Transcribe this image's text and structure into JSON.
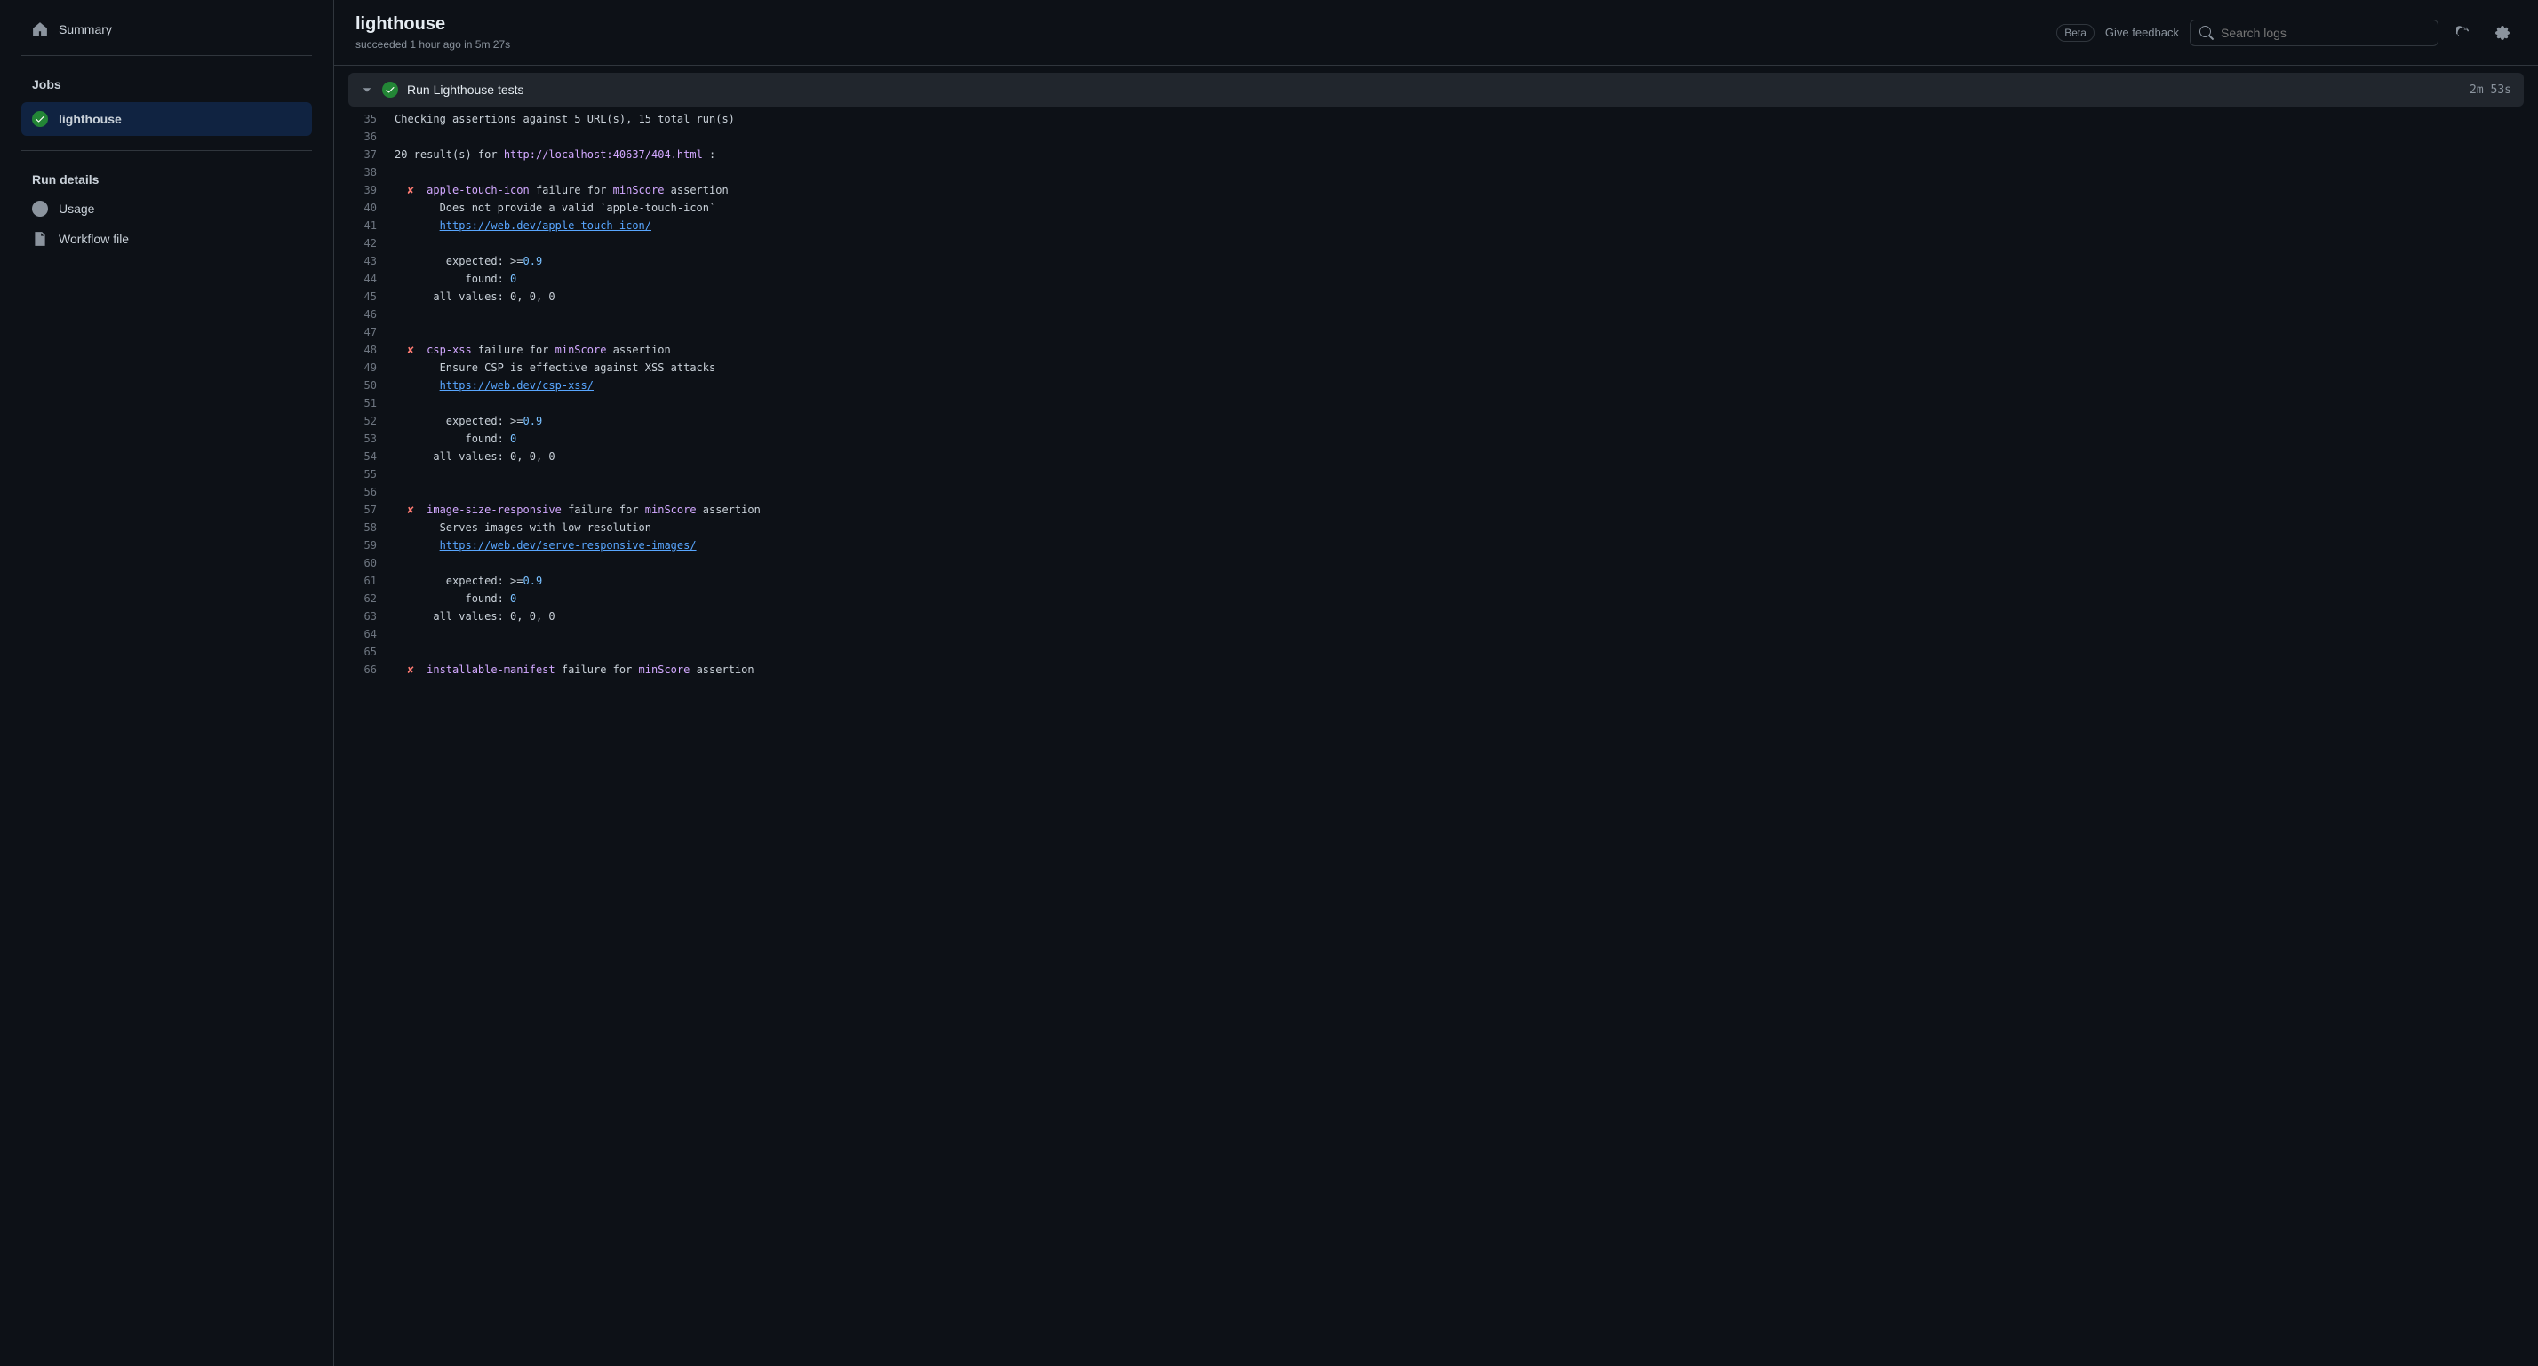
{
  "sidebar": {
    "summary_label": "Summary",
    "jobs_heading": "Jobs",
    "job_name": "lighthouse",
    "run_details_heading": "Run details",
    "usage_label": "Usage",
    "workflow_file_label": "Workflow file"
  },
  "header": {
    "title": "lighthouse",
    "subtitle": "succeeded 1 hour ago in 5m 27s",
    "beta_label": "Beta",
    "feedback_label": "Give feedback",
    "search_placeholder": "Search logs"
  },
  "step": {
    "title": "Run Lighthouse tests",
    "duration": "2m 53s"
  },
  "log": [
    {
      "n": "35",
      "segs": [
        {
          "t": "Checking assertions against 5 URL(s), 15 total run(s)",
          "c": "plain"
        }
      ]
    },
    {
      "n": "36",
      "segs": []
    },
    {
      "n": "37",
      "segs": [
        {
          "t": "20 result(s) for ",
          "c": "plain"
        },
        {
          "t": "http://localhost:40637/404.html",
          "c": "kw"
        },
        {
          "t": " :",
          "c": "plain"
        }
      ]
    },
    {
      "n": "38",
      "segs": []
    },
    {
      "n": "39",
      "segs": [
        {
          "t": "  ✘  ",
          "c": "fail"
        },
        {
          "t": "apple-touch-icon",
          "c": "kw"
        },
        {
          "t": " failure for ",
          "c": "plain"
        },
        {
          "t": "minScore",
          "c": "kw"
        },
        {
          "t": " assertion",
          "c": "plain"
        }
      ]
    },
    {
      "n": "40",
      "segs": [
        {
          "t": "       Does not provide a valid `apple-touch-icon`",
          "c": "plain"
        }
      ]
    },
    {
      "n": "41",
      "segs": [
        {
          "t": "       ",
          "c": "plain"
        },
        {
          "t": "https://web.dev/apple-touch-icon/",
          "c": "link"
        }
      ]
    },
    {
      "n": "42",
      "segs": []
    },
    {
      "n": "43",
      "segs": [
        {
          "t": "        expected: >=",
          "c": "plain"
        },
        {
          "t": "0.9",
          "c": "num"
        }
      ]
    },
    {
      "n": "44",
      "segs": [
        {
          "t": "           found: ",
          "c": "plain"
        },
        {
          "t": "0",
          "c": "num"
        }
      ]
    },
    {
      "n": "45",
      "segs": [
        {
          "t": "      all values: 0, 0, 0",
          "c": "plain"
        }
      ]
    },
    {
      "n": "46",
      "segs": []
    },
    {
      "n": "47",
      "segs": []
    },
    {
      "n": "48",
      "segs": [
        {
          "t": "  ✘  ",
          "c": "fail"
        },
        {
          "t": "csp-xss",
          "c": "kw"
        },
        {
          "t": " failure for ",
          "c": "plain"
        },
        {
          "t": "minScore",
          "c": "kw"
        },
        {
          "t": " assertion",
          "c": "plain"
        }
      ]
    },
    {
      "n": "49",
      "segs": [
        {
          "t": "       Ensure CSP is effective against XSS attacks",
          "c": "plain"
        }
      ]
    },
    {
      "n": "50",
      "segs": [
        {
          "t": "       ",
          "c": "plain"
        },
        {
          "t": "https://web.dev/csp-xss/",
          "c": "link"
        }
      ]
    },
    {
      "n": "51",
      "segs": []
    },
    {
      "n": "52",
      "segs": [
        {
          "t": "        expected: >=",
          "c": "plain"
        },
        {
          "t": "0.9",
          "c": "num"
        }
      ]
    },
    {
      "n": "53",
      "segs": [
        {
          "t": "           found: ",
          "c": "plain"
        },
        {
          "t": "0",
          "c": "num"
        }
      ]
    },
    {
      "n": "54",
      "segs": [
        {
          "t": "      all values: 0, 0, 0",
          "c": "plain"
        }
      ]
    },
    {
      "n": "55",
      "segs": []
    },
    {
      "n": "56",
      "segs": []
    },
    {
      "n": "57",
      "segs": [
        {
          "t": "  ✘  ",
          "c": "fail"
        },
        {
          "t": "image-size-responsive",
          "c": "kw"
        },
        {
          "t": " failure for ",
          "c": "plain"
        },
        {
          "t": "minScore",
          "c": "kw"
        },
        {
          "t": " assertion",
          "c": "plain"
        }
      ]
    },
    {
      "n": "58",
      "segs": [
        {
          "t": "       Serves images with low resolution",
          "c": "plain"
        }
      ]
    },
    {
      "n": "59",
      "segs": [
        {
          "t": "       ",
          "c": "plain"
        },
        {
          "t": "https://web.dev/serve-responsive-images/",
          "c": "link"
        }
      ]
    },
    {
      "n": "60",
      "segs": []
    },
    {
      "n": "61",
      "segs": [
        {
          "t": "        expected: >=",
          "c": "plain"
        },
        {
          "t": "0.9",
          "c": "num"
        }
      ]
    },
    {
      "n": "62",
      "segs": [
        {
          "t": "           found: ",
          "c": "plain"
        },
        {
          "t": "0",
          "c": "num"
        }
      ]
    },
    {
      "n": "63",
      "segs": [
        {
          "t": "      all values: 0, 0, 0",
          "c": "plain"
        }
      ]
    },
    {
      "n": "64",
      "segs": []
    },
    {
      "n": "65",
      "segs": []
    },
    {
      "n": "66",
      "segs": [
        {
          "t": "  ✘  ",
          "c": "fail"
        },
        {
          "t": "installable-manifest",
          "c": "kw"
        },
        {
          "t": " failure for ",
          "c": "plain"
        },
        {
          "t": "minScore",
          "c": "kw"
        },
        {
          "t": " assertion",
          "c": "plain"
        }
      ]
    }
  ]
}
